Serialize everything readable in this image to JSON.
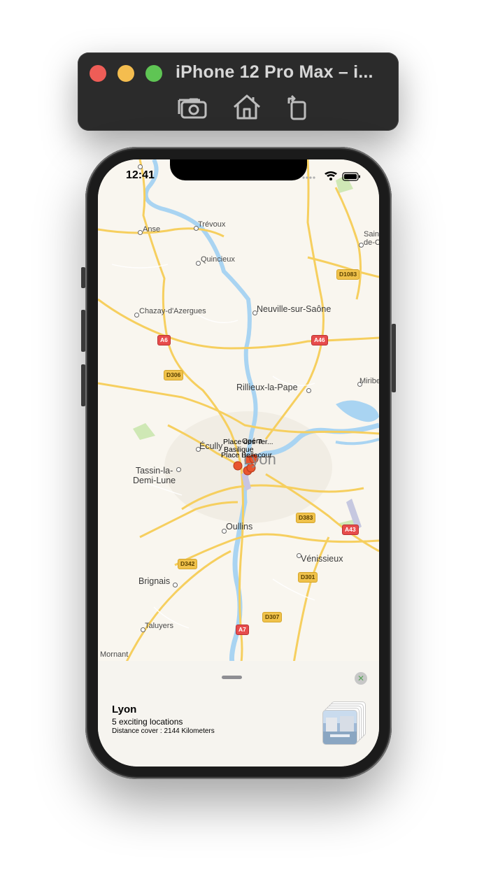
{
  "simulator": {
    "title": "iPhone 12 Pro Max – i...",
    "tools": [
      "screenshot-icon",
      "home-icon",
      "rotate-icon"
    ]
  },
  "status_bar": {
    "time": "12:41"
  },
  "map": {
    "places": {
      "anse": "Anse",
      "trevoux": "Trévoux",
      "quincieux": "Quincieux",
      "chazay": "Chazay-d'Azergues",
      "neuville": "Neuville-sur-Saône",
      "rillieux": "Rillieux-la-Pape",
      "ecully": "Écully",
      "lyon": "Lyon",
      "tassin": "Tassin-la-\nDemi-Lune",
      "oullins": "Oullins",
      "venissieux": "Vénissieux",
      "brignais": "Brignais",
      "taluyers": "Taluyers",
      "mornant": "Mornant",
      "saint_de": "Saint-\nde-C",
      "miribel": "Miribel"
    },
    "roads": {
      "d1083": "D1083",
      "a6": "A6",
      "a46": "A46",
      "d306": "D306",
      "d383": "D383",
      "a43": "A43",
      "d342": "D342",
      "d301": "D301",
      "d307": "D307",
      "a7": "A7"
    },
    "pois": {
      "p1": "Place des Ter...",
      "p2": "Opéra",
      "p3": "Basilique",
      "p4": "Place Bellecour"
    }
  },
  "sheet": {
    "title": "Lyon",
    "subtitle": "5 exciting locations",
    "distance": "Distance cover : 2144 Kilometers",
    "close_icon": "close-icon"
  },
  "colors": {
    "map_bg": "#f9f6ef",
    "water": "#a9d4f2",
    "road_major": "#f6cf5f",
    "pin": "#e8552f"
  }
}
